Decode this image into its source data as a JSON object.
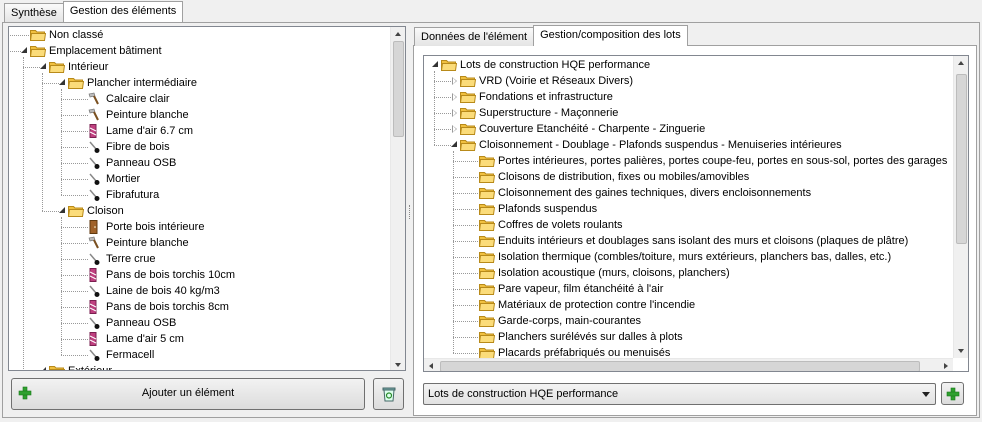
{
  "main_tabs": [
    {
      "label": "Synthèse",
      "active": false
    },
    {
      "label": "Gestion des éléments",
      "active": true
    }
  ],
  "left_tree": [
    {
      "label": "Non classé",
      "level": 0,
      "type": "folder",
      "expand": "none"
    },
    {
      "label": "Emplacement bâtiment",
      "level": 0,
      "type": "folder",
      "expand": "open"
    },
    {
      "label": "Intérieur",
      "level": 1,
      "type": "folder",
      "expand": "open"
    },
    {
      "label": "Plancher intermédiaire",
      "level": 2,
      "type": "folder",
      "expand": "open"
    },
    {
      "label": "Calcaire clair",
      "level": 3,
      "type": "trowel"
    },
    {
      "label": "Peinture blanche",
      "level": 3,
      "type": "trowel"
    },
    {
      "label": "Lame d'air 6.7 cm",
      "level": 3,
      "type": "layer"
    },
    {
      "label": "Fibre de bois",
      "level": 3,
      "type": "brush"
    },
    {
      "label": "Panneau OSB",
      "level": 3,
      "type": "brush"
    },
    {
      "label": "Mortier",
      "level": 3,
      "type": "brush"
    },
    {
      "label": "Fibrafutura",
      "level": 3,
      "type": "brush"
    },
    {
      "label": "Cloison",
      "level": 2,
      "type": "folder",
      "expand": "open"
    },
    {
      "label": "Porte bois intérieure",
      "level": 3,
      "type": "door"
    },
    {
      "label": "Peinture blanche",
      "level": 3,
      "type": "trowel"
    },
    {
      "label": "Terre crue",
      "level": 3,
      "type": "brush"
    },
    {
      "label": "Pans de bois torchis 10cm",
      "level": 3,
      "type": "layer"
    },
    {
      "label": "Laine de bois 40 kg/m3",
      "level": 3,
      "type": "brush"
    },
    {
      "label": "Pans de bois torchis 8cm",
      "level": 3,
      "type": "layer"
    },
    {
      "label": "Panneau OSB",
      "level": 3,
      "type": "brush"
    },
    {
      "label": "Lame d'air 5 cm",
      "level": 3,
      "type": "layer"
    },
    {
      "label": "Fermacell",
      "level": 3,
      "type": "brush"
    },
    {
      "label": "Extérieur",
      "level": 1,
      "type": "folder",
      "expand": "open"
    }
  ],
  "add_element_button": "Ajouter un élément",
  "right_tabs": [
    {
      "label": "Données de l'élément",
      "active": false
    },
    {
      "label": "Gestion/composition des lots",
      "active": true
    }
  ],
  "right_tree": [
    {
      "label": "Lots de construction HQE performance",
      "level": 0,
      "expand": "open"
    },
    {
      "label": "VRD (Voirie et Réseaux Divers)",
      "level": 1,
      "expand": "closed"
    },
    {
      "label": "Fondations et infrastructure",
      "level": 1,
      "expand": "closed"
    },
    {
      "label": "Superstructure - Maçonnerie",
      "level": 1,
      "expand": "closed"
    },
    {
      "label": "Couverture  Etanchéité - Charpente - Zinguerie",
      "level": 1,
      "expand": "closed"
    },
    {
      "label": "Cloisonnement - Doublage - Plafonds suspendus - Menuiseries intérieures",
      "level": 1,
      "expand": "open"
    },
    {
      "label": "Portes intérieures, portes palières, portes coupe-feu, portes en sous-sol, portes des garages",
      "level": 2,
      "expand": "none"
    },
    {
      "label": "Cloisons de distribution, fixes ou mobiles/amovibles",
      "level": 2,
      "expand": "none"
    },
    {
      "label": "Cloisonnement des gaines techniques, divers encloisonnements",
      "level": 2,
      "expand": "none"
    },
    {
      "label": "Plafonds suspendus",
      "level": 2,
      "expand": "none"
    },
    {
      "label": "Coffres de volets roulants",
      "level": 2,
      "expand": "none"
    },
    {
      "label": "Enduits intérieurs et doublages sans isolant des murs et cloisons (plaques de plâtre)",
      "level": 2,
      "expand": "none"
    },
    {
      "label": "Isolation thermique (combles/toiture, murs extérieurs, planchers bas, dalles, etc.)",
      "level": 2,
      "expand": "none"
    },
    {
      "label": "Isolation acoustique (murs, cloisons, planchers)",
      "level": 2,
      "expand": "none"
    },
    {
      "label": "Pare vapeur, film étanchéité à l'air",
      "level": 2,
      "expand": "none"
    },
    {
      "label": "Matériaux de protection contre l'incendie",
      "level": 2,
      "expand": "none"
    },
    {
      "label": "Garde-corps, main-courantes",
      "level": 2,
      "expand": "none"
    },
    {
      "label": "Planchers surélévés sur dalles à plots",
      "level": 2,
      "expand": "none"
    },
    {
      "label": "Placards préfabriqués ou menuisés",
      "level": 2,
      "expand": "none"
    }
  ],
  "lot_select": {
    "value": "Lots de construction HQE performance"
  },
  "icons": {
    "add": "plus-icon",
    "delete": "recycle-bin-icon",
    "dropdown": "chevron-down-icon"
  },
  "colors": {
    "folder": "#f5c842",
    "add_green": "#2fa02f"
  }
}
